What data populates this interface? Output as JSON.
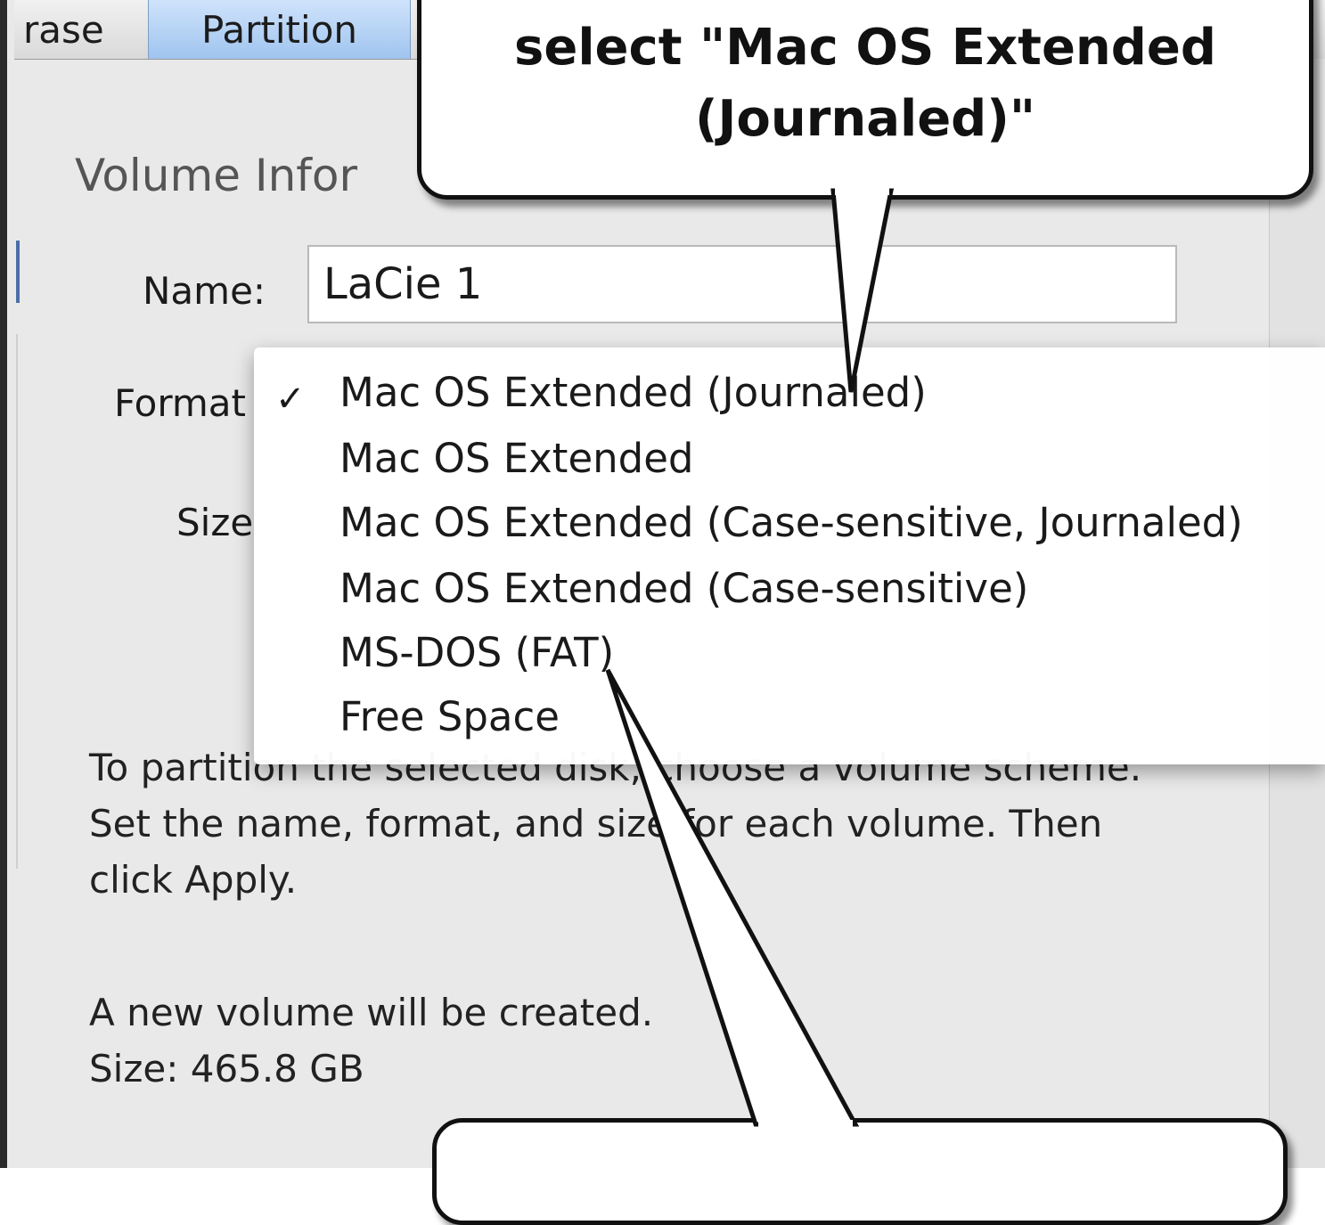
{
  "tabs": {
    "erase": "rase",
    "partition": "Partition"
  },
  "volume_info": {
    "title": "Volume Infor",
    "name_label": "Name:",
    "name_value": "LaCie 1",
    "format_label": "Format",
    "size_label": "Size"
  },
  "format_menu": {
    "selected_index": 0,
    "check_glyph": "✓",
    "items": [
      "Mac OS Extended (Journaled)",
      "Mac OS Extended",
      "Mac OS Extended (Case-sensitive, Journaled)",
      "Mac OS Extended (Case-sensitive)",
      "MS-DOS (FAT)",
      "Free Space"
    ]
  },
  "description": {
    "instructions": "To partition the selected disk, choose a volume scheme. Set the name, format, and size for each volume. Then click Apply.",
    "status_line1": "A new volume will be created.",
    "status_line2": "Size: 465.8 GB"
  },
  "callouts": {
    "top_line1": "select \"Mac OS Extended",
    "top_line2": "(Journaled)\""
  }
}
